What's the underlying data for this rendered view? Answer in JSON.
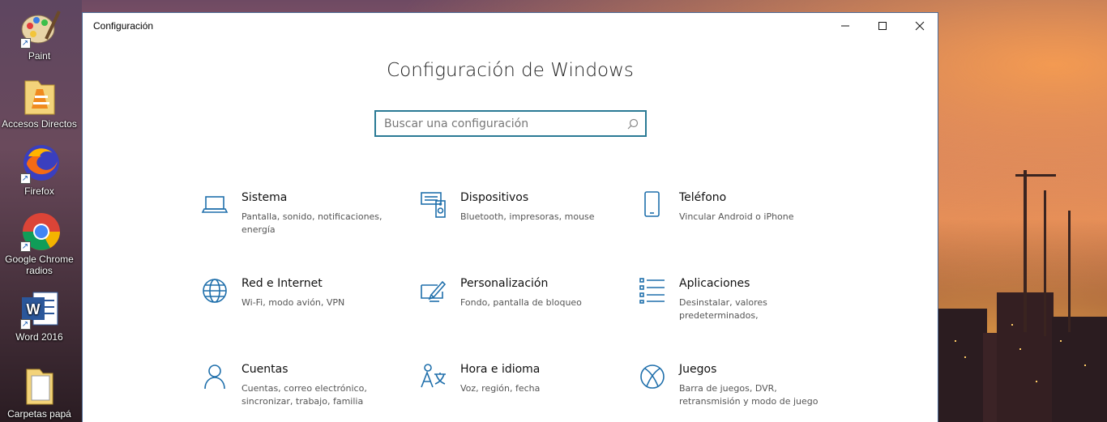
{
  "desktop": {
    "icons": [
      {
        "label": "Paint",
        "icon": "paint-icon"
      },
      {
        "label": "Accesos Directos",
        "icon": "folder-vlc-icon"
      },
      {
        "label": "Firefox",
        "icon": "firefox-icon"
      },
      {
        "label": "Google Chrome radios",
        "icon": "chrome-icon"
      },
      {
        "label": "Word 2016",
        "icon": "word-icon"
      },
      {
        "label": "Carpetas papá",
        "icon": "folder-icon"
      }
    ]
  },
  "window": {
    "title": "Configuración",
    "heading": "Configuración de Windows",
    "search": {
      "placeholder": "Buscar una configuración",
      "value": ""
    },
    "tiles": [
      {
        "name": "Sistema",
        "desc": "Pantalla, sonido, notificaciones, energía",
        "icon": "laptop-icon"
      },
      {
        "name": "Dispositivos",
        "desc": "Bluetooth, impresoras, mouse",
        "icon": "devices-icon"
      },
      {
        "name": "Teléfono",
        "desc": "Vincular Android o iPhone",
        "icon": "phone-icon"
      },
      {
        "name": "Red e Internet",
        "desc": "Wi-Fi, modo avión, VPN",
        "icon": "globe-icon"
      },
      {
        "name": "Personalización",
        "desc": "Fondo, pantalla de bloqueo",
        "icon": "personalization-icon"
      },
      {
        "name": "Aplicaciones",
        "desc": "Desinstalar, valores predeterminados,",
        "icon": "apps-list-icon"
      },
      {
        "name": "Cuentas",
        "desc": "Cuentas, correo electrónico, sincronizar, trabajo, familia",
        "icon": "person-icon"
      },
      {
        "name": "Hora e idioma",
        "desc": "Voz, región, fecha",
        "icon": "time-language-icon"
      },
      {
        "name": "Juegos",
        "desc": "Barra de juegos, DVR, retransmisión y modo de juego",
        "icon": "xbox-icon"
      }
    ]
  },
  "colors": {
    "accent": "#1f6fab",
    "search_border": "#2a7a95",
    "window_border": "#4e6b96"
  }
}
